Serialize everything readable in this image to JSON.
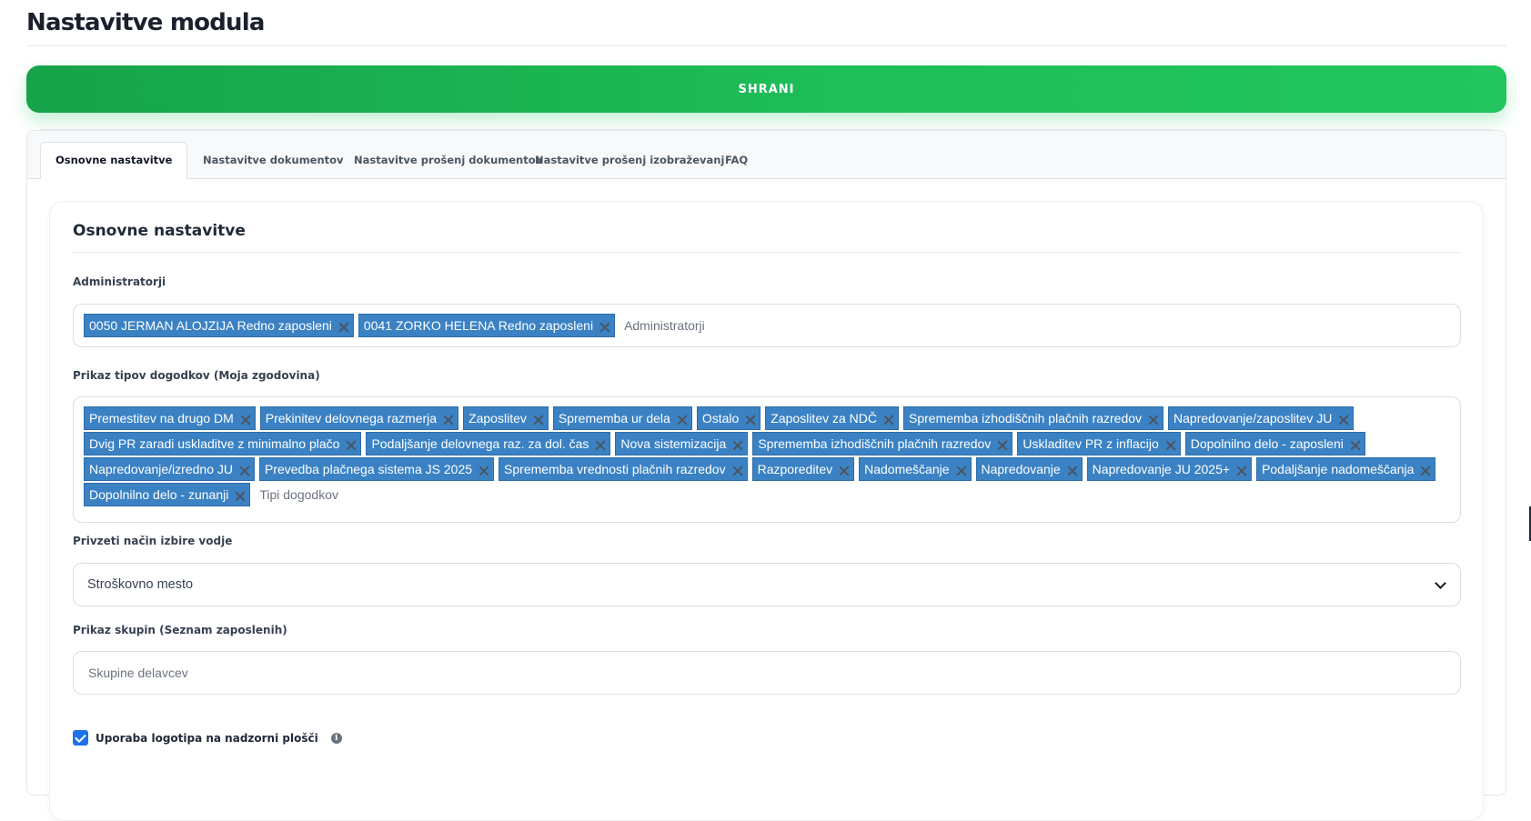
{
  "page": {
    "title": "Nastavitve modula"
  },
  "toolbar": {
    "save_label": "SHRANI"
  },
  "tabs": [
    {
      "label": "Osnovne nastavitve",
      "active": true
    },
    {
      "label": "Nastavitve dokumentov",
      "active": false
    },
    {
      "label": "Nastavitve prošenj dokumentov",
      "active": false
    },
    {
      "label": "Nastavitve prošenj izobraževanj",
      "active": false
    },
    {
      "label": "FAQ",
      "active": false
    }
  ],
  "section": {
    "title": "Osnovne nastavitve",
    "administrators": {
      "label": "Administratorji",
      "tags": [
        "0050 JERMAN ALOJZIJA Redno zaposleni",
        "0041 ZORKO HELENA Redno zaposleni"
      ],
      "placeholder": "Administratorji"
    },
    "event_types": {
      "label": "Prikaz tipov dogodkov (Moja zgodovina)",
      "tags": [
        "Premestitev na drugo DM",
        "Prekinitev delovnega razmerja",
        "Zaposlitev",
        "Sprememba ur dela",
        "Ostalo",
        "Zaposlitev za NDČ",
        "Sprememba izhodiščnih plačnih razredov",
        "Napredovanje/zaposlitev JU",
        "Dvig PR zaradi uskladitve z minimalno plačo",
        "Podaljšanje delovnega raz. za dol. čas",
        "Nova sistemizacija",
        "Sprememba izhodiščnih plačnih razredov",
        "Uskladitev PR z inflacijo",
        "Dopolnilno delo - zaposleni",
        "Napredovanje/izredno JU",
        "Prevedba plačnega sistema JS 2025",
        "Sprememba vrednosti plačnih razredov",
        "Razporeditev",
        "Nadomeščanje",
        "Napredovanje",
        "Napredovanje JU 2025+",
        "Podaljšanje nadomeščanja",
        "Dopolnilno delo - zunanji"
      ],
      "placeholder": "Tipi dogodkov"
    },
    "leader_selection": {
      "label": "Privzeti način izbire vodje",
      "value": "Stroškovno mesto"
    },
    "groups": {
      "label": "Prikaz skupin (Seznam zaposlenih)",
      "placeholder": "Skupine delavcev"
    },
    "logo_option": {
      "label": "Uporaba logotipa na nadzorni plošči",
      "checked": true
    }
  },
  "colors": {
    "accent": "#22c55e",
    "tag_bg": "#3b82c4",
    "checkbox": "#1d72e8"
  }
}
